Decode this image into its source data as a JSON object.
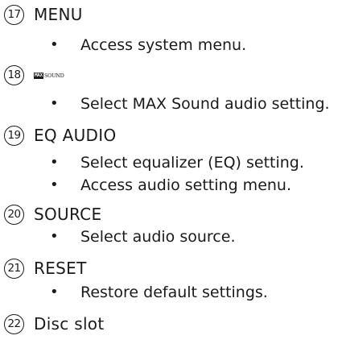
{
  "items": [
    {
      "number": "17",
      "title": "MENU",
      "bullets": [
        "Access system menu."
      ]
    },
    {
      "number": "18",
      "logo": {
        "box_text": "MAX",
        "word_text": "SOUND"
      },
      "bullets": [
        "Select MAX Sound audio setting."
      ]
    },
    {
      "number": "19",
      "title": "EQ AUDIO",
      "bullets": [
        "Select equalizer (EQ) setting.",
        "Access audio setting menu."
      ]
    },
    {
      "number": "20",
      "title": "SOURCE",
      "bullets": [
        "Select audio source."
      ]
    },
    {
      "number": "21",
      "title": "RESET",
      "bullets": [
        "Restore default settings."
      ]
    },
    {
      "number": "22",
      "title": "Disc slot",
      "bullets": []
    }
  ],
  "bullet_symbol": "•"
}
